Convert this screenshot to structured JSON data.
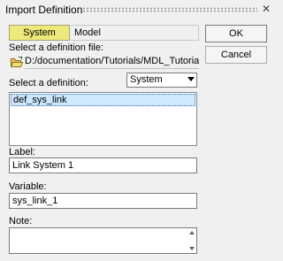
{
  "window": {
    "title": "Import Definition",
    "close_glyph": "✕"
  },
  "tabs": [
    {
      "label": "System",
      "active": true
    },
    {
      "label": "Model",
      "active": false
    }
  ],
  "buttons": {
    "ok_label": "OK",
    "cancel_label": "Cancel"
  },
  "file": {
    "label": "Select a definition file:",
    "path": "D:/documentation/Tutorials/MDL_Tutorial/sys_"
  },
  "definition": {
    "label": "Select a definition:",
    "type_value": "System",
    "items": [
      "def_sys_link"
    ]
  },
  "label_field": {
    "label": "Label:",
    "value": "Link System 1"
  },
  "variable_field": {
    "label": "Variable:",
    "value": "sys_link_1"
  },
  "note_field": {
    "label": "Note:",
    "value": ""
  },
  "colors": {
    "active_tab": "#ede97a",
    "list_selection": "#cde8ff"
  }
}
